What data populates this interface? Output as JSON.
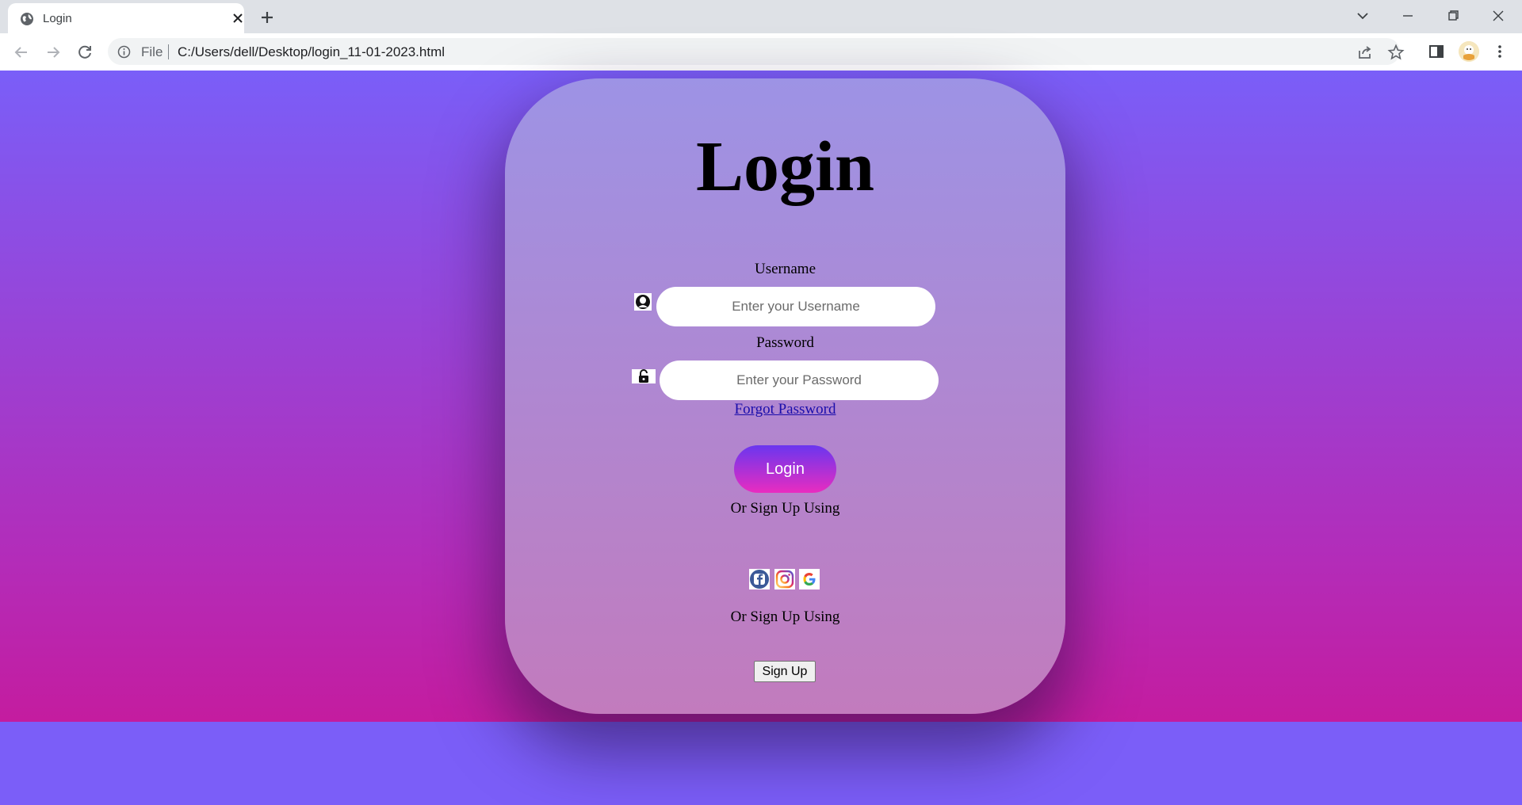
{
  "browser": {
    "tab": {
      "title": "Login"
    },
    "address": {
      "scheme_label": "File",
      "url": "C:/Users/dell/Desktop/login_11-01-2023.html"
    }
  },
  "login_card": {
    "title": "Login",
    "username": {
      "label": "Username",
      "placeholder": "Enter your Username"
    },
    "password": {
      "label": "Password",
      "placeholder": "Enter your Password"
    },
    "forgot_password": "Forgot Password",
    "login_button": "Login",
    "or_sign_up_1": "Or Sign Up Using",
    "social_icons": [
      "facebook-icon",
      "instagram-icon",
      "google-icon"
    ],
    "or_sign_up_2": "Or Sign Up Using",
    "sign_up_button": "Sign Up"
  },
  "colors": {
    "page_top": "#7a5ef8",
    "page_bottom": "#c41c9f",
    "card_top": "#9d93e5",
    "card_bottom": "#c27bbd",
    "login_button_top": "#6a36ef",
    "login_button_bottom": "#e92cc0",
    "link": "#1a0dab"
  }
}
